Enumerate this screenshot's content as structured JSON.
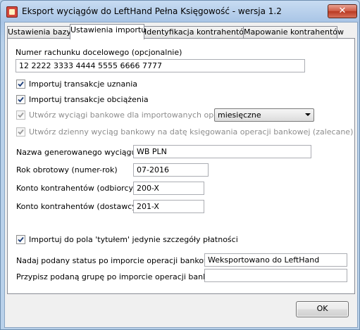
{
  "window": {
    "title": "Eksport wyciągów do LeftHand Pełna Księgowość - wersja 1.2",
    "close_label": "✕"
  },
  "tabs": [
    {
      "label": "Ustawienia bazy"
    },
    {
      "label": "Ustawienia importu"
    },
    {
      "label": "Identyfikacja kontrahentów"
    },
    {
      "label": "Mapowanie kontrahentów"
    }
  ],
  "form": {
    "account_label": "Numer rachunku docelowego (opcjonalnie)",
    "account_value": "12 2222 3333 4444 5555 6666 7777",
    "import_credit_label": "Importuj transakcje uznania",
    "import_credit_checked": true,
    "import_debit_label": "Importuj transakcje obciążenia",
    "import_debit_checked": true,
    "create_statements_label": "Utwórz wyciągi bankowe dla importowanych operacji",
    "create_statements_checked": true,
    "period_value": "miesięczne",
    "daily_statement_label": "Utwórz dzienny wyciąg bankowy na datę księgowania operacji bankowej (zalecane)",
    "daily_statement_checked": true,
    "statement_name_label": "Nazwa generowanego wyciągu",
    "statement_name_value": "WB PLN",
    "fiscal_year_label": "Rok obrotowy (numer-rok)",
    "fiscal_year_value": "07-2016",
    "receivers_account_label": "Konto kontrahentów (odbiorcy)",
    "receivers_account_value": "200-X",
    "suppliers_account_label": "Konto kontrahentów (dostawcy)",
    "suppliers_account_value": "201-X",
    "title_details_label": "Importuj do pola 'tytułem' jedynie szczegóły płatności",
    "title_details_checked": true,
    "status_label": "Nadaj podany status po imporcie operacji bankowej",
    "status_value": "Weksportowano do LeftHand",
    "group_label": "Przypisz podaną grupę po imporcie operacji bankowej",
    "group_value": ""
  },
  "ok_label": "OK",
  "colors": {
    "titlebar": "#b9d1ea",
    "close_button": "#c94f36",
    "check_enabled": "#1c3e7a",
    "check_disabled": "#9a9a9a"
  }
}
